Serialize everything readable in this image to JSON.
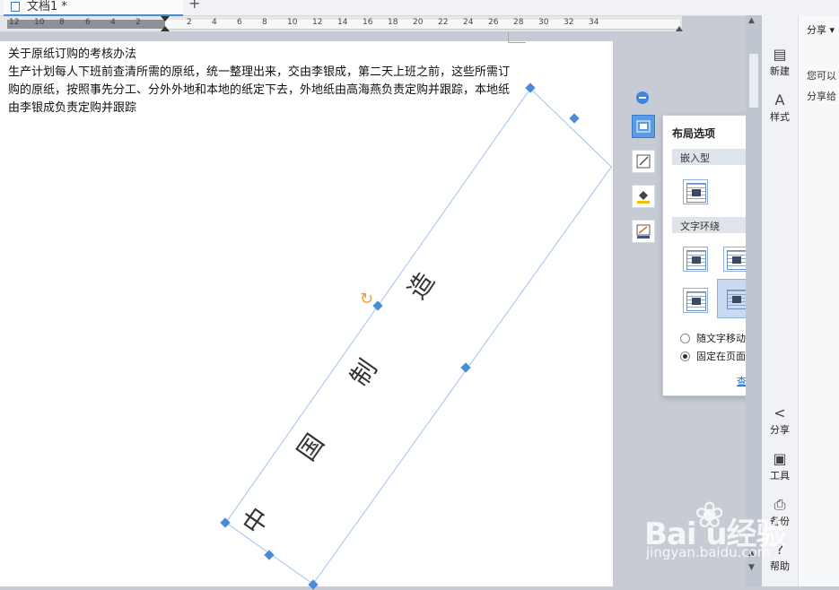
{
  "tab": {
    "title": "文档1 *",
    "new_tab": "+"
  },
  "ruler": {
    "numbers": [
      "12",
      "10",
      "8",
      "6",
      "4",
      "2",
      "2",
      "4",
      "6",
      "8",
      "10",
      "12",
      "14",
      "16",
      "18",
      "20",
      "22",
      "24",
      "26",
      "28",
      "30",
      "32",
      "34"
    ]
  },
  "document": {
    "heading": "关于原纸订购的考核办法",
    "body": "生产计划每人下班前查清所需的原纸，统一整理出来，交由李银成，第二天上班之前，这些所需订购的原纸，按照事先分工、分外外地和本地的纸定下去，外地纸由高海燕负责定购并跟踪，本地纸由李银成负责定购并跟踪",
    "textbox_chars": [
      "中",
      "国",
      "制",
      "造"
    ]
  },
  "float_tools": [
    {
      "name": "layout-options-icon",
      "active": true
    },
    {
      "name": "shape-edit-icon",
      "active": false
    },
    {
      "name": "fill-color-icon",
      "active": false
    },
    {
      "name": "outline-color-icon",
      "active": false
    }
  ],
  "layout_panel": {
    "title": "布局选项",
    "close": "×",
    "section_inline": "嵌入型",
    "section_wrap": "文字环绕",
    "radio_move": "随文字移动",
    "radio_fixed": "固定在页面上",
    "see_more": "查看更多..."
  },
  "sidebar": {
    "items": [
      {
        "label": "新建",
        "glyph": "▤"
      },
      {
        "label": "样式",
        "glyph": "A"
      },
      {
        "label": "分享",
        "glyph": "<"
      },
      {
        "label": "工具",
        "glyph": "▣"
      },
      {
        "label": "备份",
        "glyph": "⎙"
      },
      {
        "label": "帮助",
        "glyph": "?"
      }
    ]
  },
  "share_pane": {
    "title": "分享 ▾",
    "line1": "您可以",
    "line2": "分享给"
  },
  "watermark": {
    "main": "Bai  u经验",
    "sub": "jingyan.baidu.com"
  }
}
